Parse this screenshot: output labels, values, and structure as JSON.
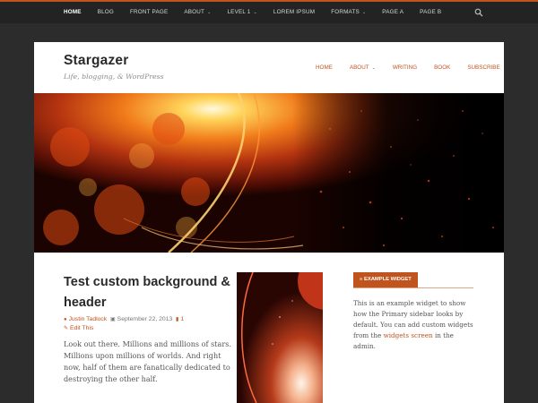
{
  "top_nav": {
    "items": [
      {
        "label": "HOME"
      },
      {
        "label": "BLOG"
      },
      {
        "label": "FRONT PAGE"
      },
      {
        "label": "ABOUT"
      },
      {
        "label": "LEVEL 1"
      },
      {
        "label": "LOREM IPSUM"
      },
      {
        "label": "FORMATS"
      },
      {
        "label": "PAGE A"
      },
      {
        "label": "PAGE B"
      }
    ],
    "search_icon": "search-icon"
  },
  "site": {
    "title": "Stargazer",
    "description": "Life, blogging, & WordPress"
  },
  "primary_nav": {
    "items": [
      {
        "label": "HOME"
      },
      {
        "label": "ABOUT"
      },
      {
        "label": "WRITING"
      },
      {
        "label": "BOOK"
      },
      {
        "label": "SUBSCRIBE"
      }
    ]
  },
  "post": {
    "title": "Test custom background & header",
    "author": "Justin Tadlock",
    "date": "September 22, 2013",
    "comments": "1",
    "edit_label": "Edit This",
    "excerpt": "Look out there. Millions and millions of stars. Millions upon millions of worlds. And right now, half of them are fanatically dedicated to destroying the other half."
  },
  "widget": {
    "title": "EXAMPLE WIDGET",
    "text_before": "This is an example widget to show how the Primary sidebar looks by default. You can add custom widgets from the ",
    "link": "widgets screen",
    "text_after": " in the admin."
  },
  "colors": {
    "accent": "#c0541f",
    "top_bar": "#232323",
    "background": "#2c2c2c"
  }
}
